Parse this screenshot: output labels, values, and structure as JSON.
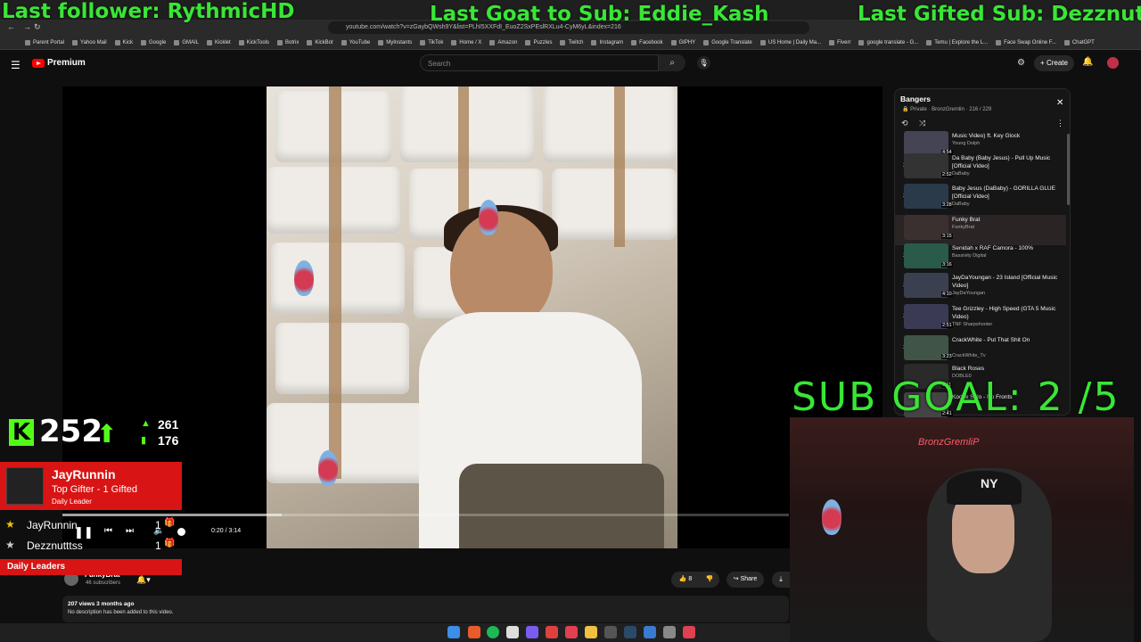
{
  "overlay": {
    "last_follower": "Last follower: RythmicHD",
    "last_goat": "Last Goat to Sub: Eddie_Kash",
    "last_gifted": "Last Gifted Sub: Dezznutttss",
    "sub_goal": "SUB GOAL: 2 /5"
  },
  "browser": {
    "url": "youtube.com/watch?v=zGaybQWsh9Y&list=PLhI5XXFdI_EuoZ2SxPEslRXLu4-CyM6yL&index=216",
    "bookmarks": [
      "Parent Portal",
      "Yahoo Mail",
      "Kick",
      "Google",
      "GMAIL",
      "Kicklet",
      "KickTools",
      "Botrix",
      "KickBot",
      "YouTube",
      "MyInstants",
      "TikTok",
      "Home / X",
      "Amazon",
      "Puzzles",
      "Twitch",
      "Instagram",
      "Facebook",
      "GIPHY",
      "Google Translate",
      "US Home | Daily Ma...",
      "Fiverr",
      "google translate - G...",
      "Temu | Explore the L...",
      "Face Swap Online F...",
      "ChatGPT"
    ]
  },
  "youtube": {
    "brand": "Premium",
    "search_placeholder": "Search",
    "create_label": "Create"
  },
  "player": {
    "time": "0:20 / 3:14",
    "progress": 0.103
  },
  "video": {
    "channel": "FunkyBrat",
    "subscribers": "46 subscribers",
    "likes": "8",
    "share": "Share",
    "views": "207 views  3 months ago",
    "description": "No description has been added to this video."
  },
  "playlist": {
    "title": "Bangers",
    "privacy": "Private",
    "owner": "BronzGremlin",
    "position": "216 / 229",
    "items": [
      {
        "num": "",
        "title": "Music Video) ft. Key Glock",
        "channel": "Young Dolph",
        "duration": "4:54"
      },
      {
        "num": "214",
        "title": "Da Baby (Baby Jesus) - Pull Up Music [Official Video]",
        "channel": "DaBaby",
        "duration": "2:52"
      },
      {
        "num": "215",
        "title": "Baby Jesus (DaBaby) - GORILLA GLUE [Official Video]",
        "channel": "DaBaby",
        "duration": "3:28"
      },
      {
        "num": "▶",
        "title": "Funky Brat",
        "channel": "FunkyBrat",
        "duration": "3:15"
      },
      {
        "num": "217",
        "title": "Senidah x RAF Camora - 100%",
        "channel": "Bassivity Digital",
        "duration": "3:16"
      },
      {
        "num": "218",
        "title": "JayDaYoungan - 23 Island [Official Music Video]",
        "channel": "JayDaYoungan",
        "duration": "4:10"
      },
      {
        "num": "219",
        "title": "Tee Grizzley - High Speed (GTA 5 Music Video)",
        "channel": "TNF Sharpshooter",
        "duration": "2:51"
      },
      {
        "num": "220",
        "title": "CrackWhite - Put That Shit On",
        "channel": "CrackWhite_Tv",
        "duration": "3:23"
      },
      {
        "num": "",
        "title": "Black Roses",
        "channel": "DOBLE0",
        "duration": "3:11"
      },
      {
        "num": "",
        "title": "Kodak Solo - No Fronts",
        "channel": "",
        "duration": "2:41"
      }
    ]
  },
  "kick": {
    "logo": "K",
    "viewers": "252",
    "stat1": "261",
    "stat2": "176",
    "leader_name": "JayRunnin",
    "leader_sub": "Top Gifter - 1 Gifted",
    "leader_label": "Daily Leader",
    "leaderboard": [
      {
        "name": "JayRunnin",
        "count": "1"
      },
      {
        "name": "Dezznutttss",
        "count": "1"
      }
    ],
    "daily_leaders": "Daily Leaders"
  },
  "cam": {
    "neon": "BronzGremliP",
    "hat": "NY"
  },
  "colors": {
    "overlay_green": "#39e636",
    "kick_green": "#53fc18",
    "leader_red": "#d81414",
    "yt_red": "#ff0000"
  }
}
